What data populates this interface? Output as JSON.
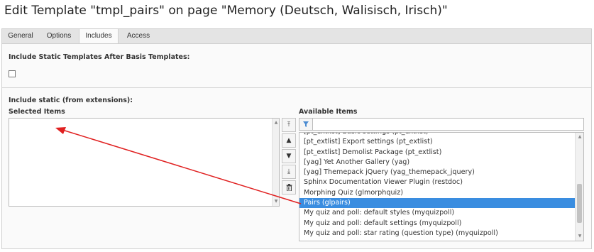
{
  "page": {
    "title": "Edit Template \"tmpl_pairs\" on page \"Memory (Deutsch, Walisisch, Irisch)\""
  },
  "tabs": [
    {
      "label": "General"
    },
    {
      "label": "Options"
    },
    {
      "label": "Includes"
    },
    {
      "label": "Access"
    }
  ],
  "includes": {
    "static_after_basis_label": "Include Static Templates After Basis Templates:",
    "static_after_basis_checked": false,
    "include_static_label": "Include static (from extensions):",
    "selected_items_label": "Selected Items",
    "available_items_label": "Available Items",
    "filter_value": "",
    "available_items": [
      {
        "label": "[pt_extlist] Basic settings (pt_extlist)",
        "selected": false
      },
      {
        "label": "[pt_extlist] Export settings (pt_extlist)",
        "selected": false
      },
      {
        "label": "[pt_extlist] Demolist Package (pt_extlist)",
        "selected": false
      },
      {
        "label": "[yag] Yet Another Gallery (yag)",
        "selected": false
      },
      {
        "label": "[yag] Themepack jQuery (yag_themepack_jquery)",
        "selected": false
      },
      {
        "label": "Sphinx Documentation Viewer Plugin (restdoc)",
        "selected": false
      },
      {
        "label": "Morphing Quiz (glmorphquiz)",
        "selected": false
      },
      {
        "label": "Pairs (glpairs)",
        "selected": true
      },
      {
        "label": "My quiz and poll: default styles (myquizpoll)",
        "selected": false
      },
      {
        "label": "My quiz and poll: default settings (myquizpoll)",
        "selected": false
      },
      {
        "label": "My quiz and poll: star rating (question type) (myquizpoll)",
        "selected": false
      }
    ]
  },
  "icons": {
    "move_top": "move-to-top-icon",
    "move_up": "move-up-icon",
    "move_down": "move-down-icon",
    "move_bottom": "move-to-bottom-icon",
    "remove": "trash-icon",
    "filter": "filter-icon"
  },
  "colors": {
    "selection": "#3a8de0",
    "annotation_arrow": "#e02020"
  }
}
